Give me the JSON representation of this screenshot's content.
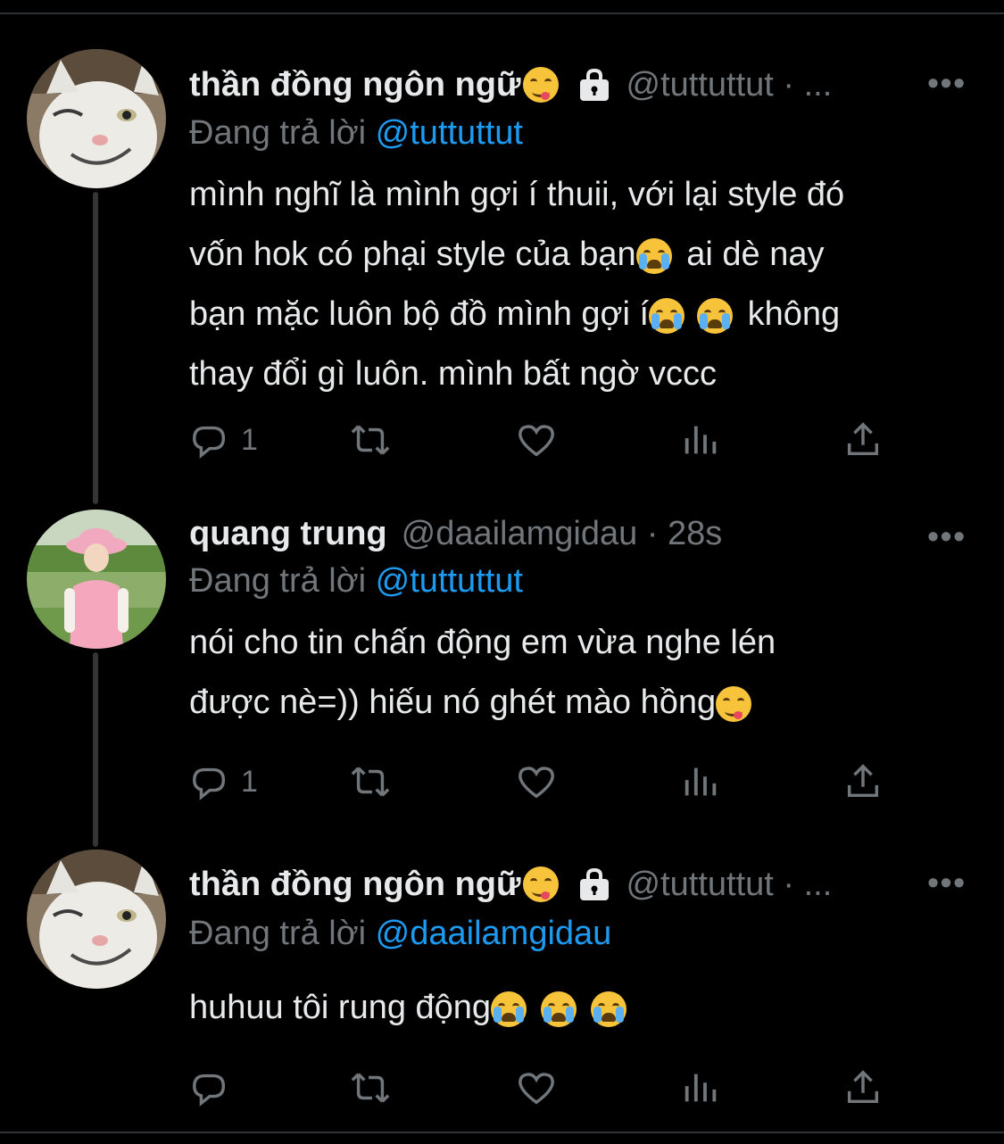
{
  "colors": {
    "background": "#000000",
    "text": "#e7e9ea",
    "muted": "#71767b",
    "link": "#1d9bf0",
    "thread_line": "#333639"
  },
  "tweets": [
    {
      "name": "thần đồng ngôn ngữ",
      "name_emoji": "face-savoring-food",
      "locked": true,
      "handle": "@tuttuttut · ...",
      "more": "•••",
      "reply_prefix": "Đang trả lời",
      "reply_to": "@tuttuttut",
      "lines": [
        "mình nghĩ là mình gợi í thuii, với lại style đó",
        "vốn hok có phại style của bạn",
        " ai dè nay",
        "bạn mặc luôn bộ đồ mình gợi í",
        " không",
        "thay đổi gì luôn. mình bất ngờ vccc"
      ],
      "reply_count": "1"
    },
    {
      "name": "quang trung",
      "locked": false,
      "handle": "@daailamgidau · 28s",
      "more": "•••",
      "reply_prefix": "Đang trả lời",
      "reply_to": "@tuttuttut",
      "lines": [
        "nói cho tin chấn động em vừa nghe lén",
        "được nè=)) hiếu nó ghét mào hồng"
      ],
      "reply_count": "1"
    },
    {
      "name": "thần đồng ngôn ngữ",
      "name_emoji": "face-savoring-food",
      "locked": true,
      "handle": "@tuttuttut · ...",
      "more": "•••",
      "reply_prefix": "Đang trả lời",
      "reply_to": "@daailamgidau",
      "lines": [
        "huhuu tôi rung động"
      ],
      "reply_count": ""
    }
  ],
  "icons": [
    "reply-icon",
    "retweet-icon",
    "like-icon",
    "views-icon",
    "share-icon",
    "lock-icon",
    "more-icon"
  ]
}
